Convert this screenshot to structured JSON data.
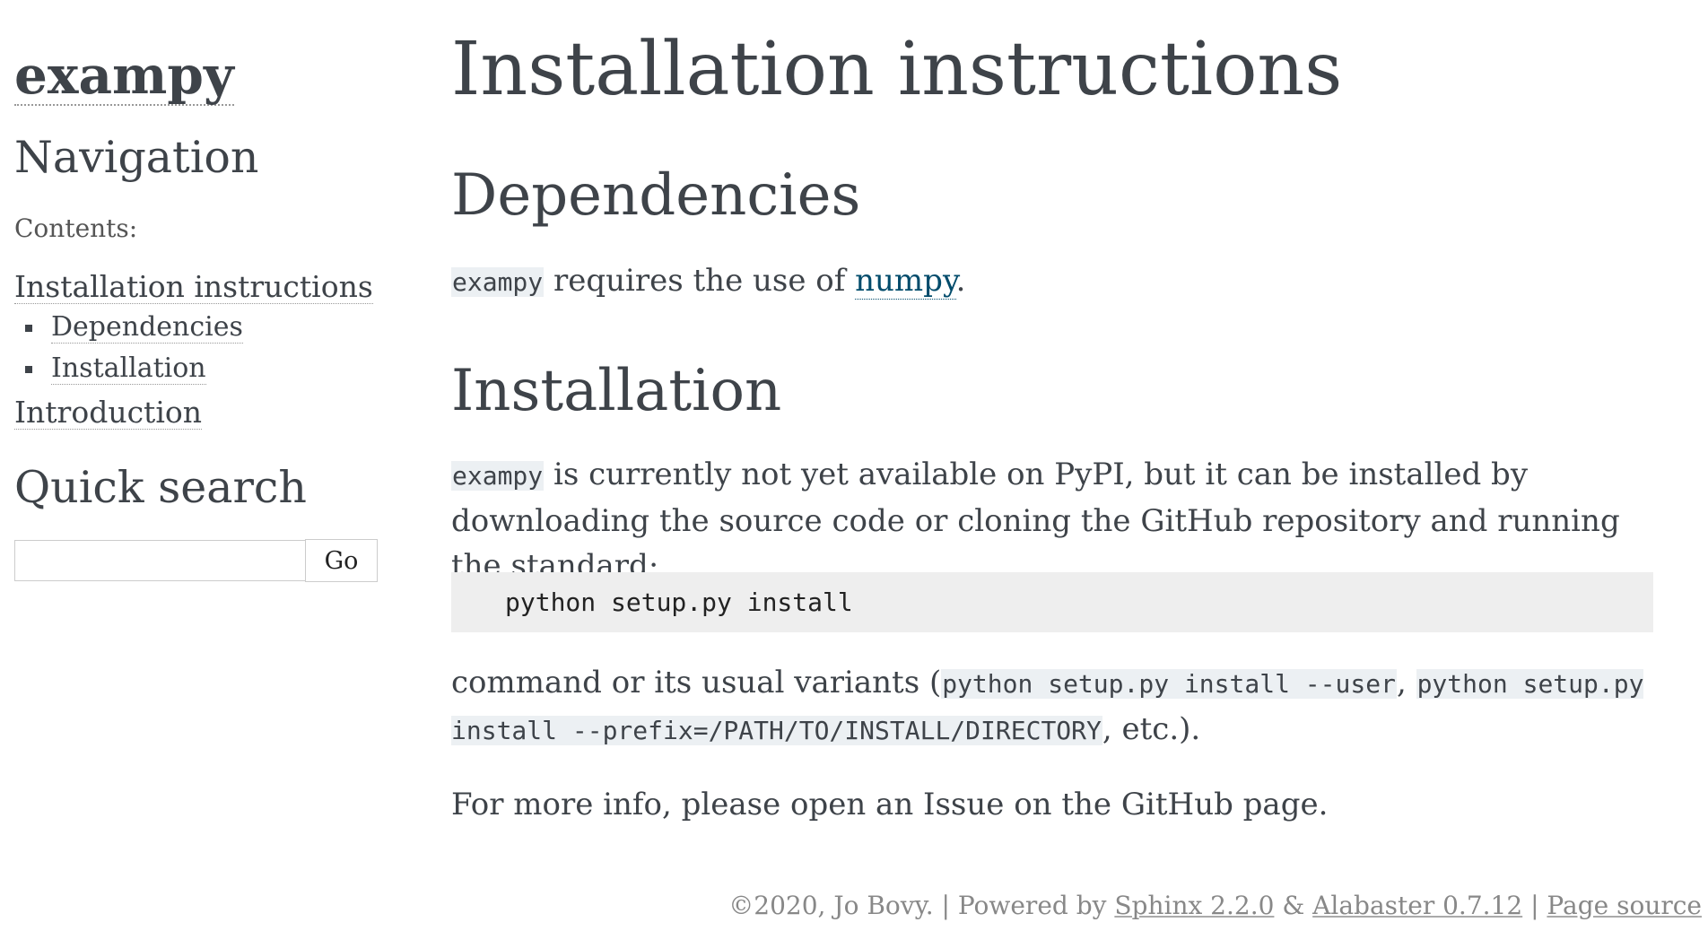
{
  "sidebar": {
    "logo": "exampy",
    "navigation_heading": "Navigation",
    "contents_caption": "Contents:",
    "toc": {
      "item1": "Installation instructions",
      "sub_items": [
        "Dependencies",
        "Installation"
      ],
      "item2": "Introduction"
    },
    "quick_search_heading": "Quick search",
    "search": {
      "value": "",
      "button_label": "Go"
    }
  },
  "main": {
    "title": "Installation instructions",
    "dependencies": {
      "heading": "Dependencies",
      "code": "exampy",
      "text_before_link": " requires the use of ",
      "link_text": "numpy",
      "text_after_link": "."
    },
    "installation": {
      "heading": "Installation",
      "code": "exampy",
      "text": " is currently not yet available on PyPI, but it can be installed by downloading the source code or cloning the GitHub repository and running the standard:",
      "command": "python setup.py install",
      "variants_prefix": "command or its usual variants (",
      "variant1": "python setup.py install --user",
      "variants_sep": ", ",
      "variant2": "python setup.py install --prefix=/PATH/TO/INSTALL/DIRECTORY",
      "variants_suffix": ", etc.).",
      "more_info": "For more info, please open an Issue on the GitHub page."
    }
  },
  "footer": {
    "copyright": "©2020, Jo Bovy.",
    "sep1": " | ",
    "powered_by": "Powered by ",
    "sphinx_link": "Sphinx 2.2.0",
    "amp": " & ",
    "alabaster_link": "Alabaster 0.7.12",
    "sep2": " | ",
    "page_source_link": "Page source"
  }
}
